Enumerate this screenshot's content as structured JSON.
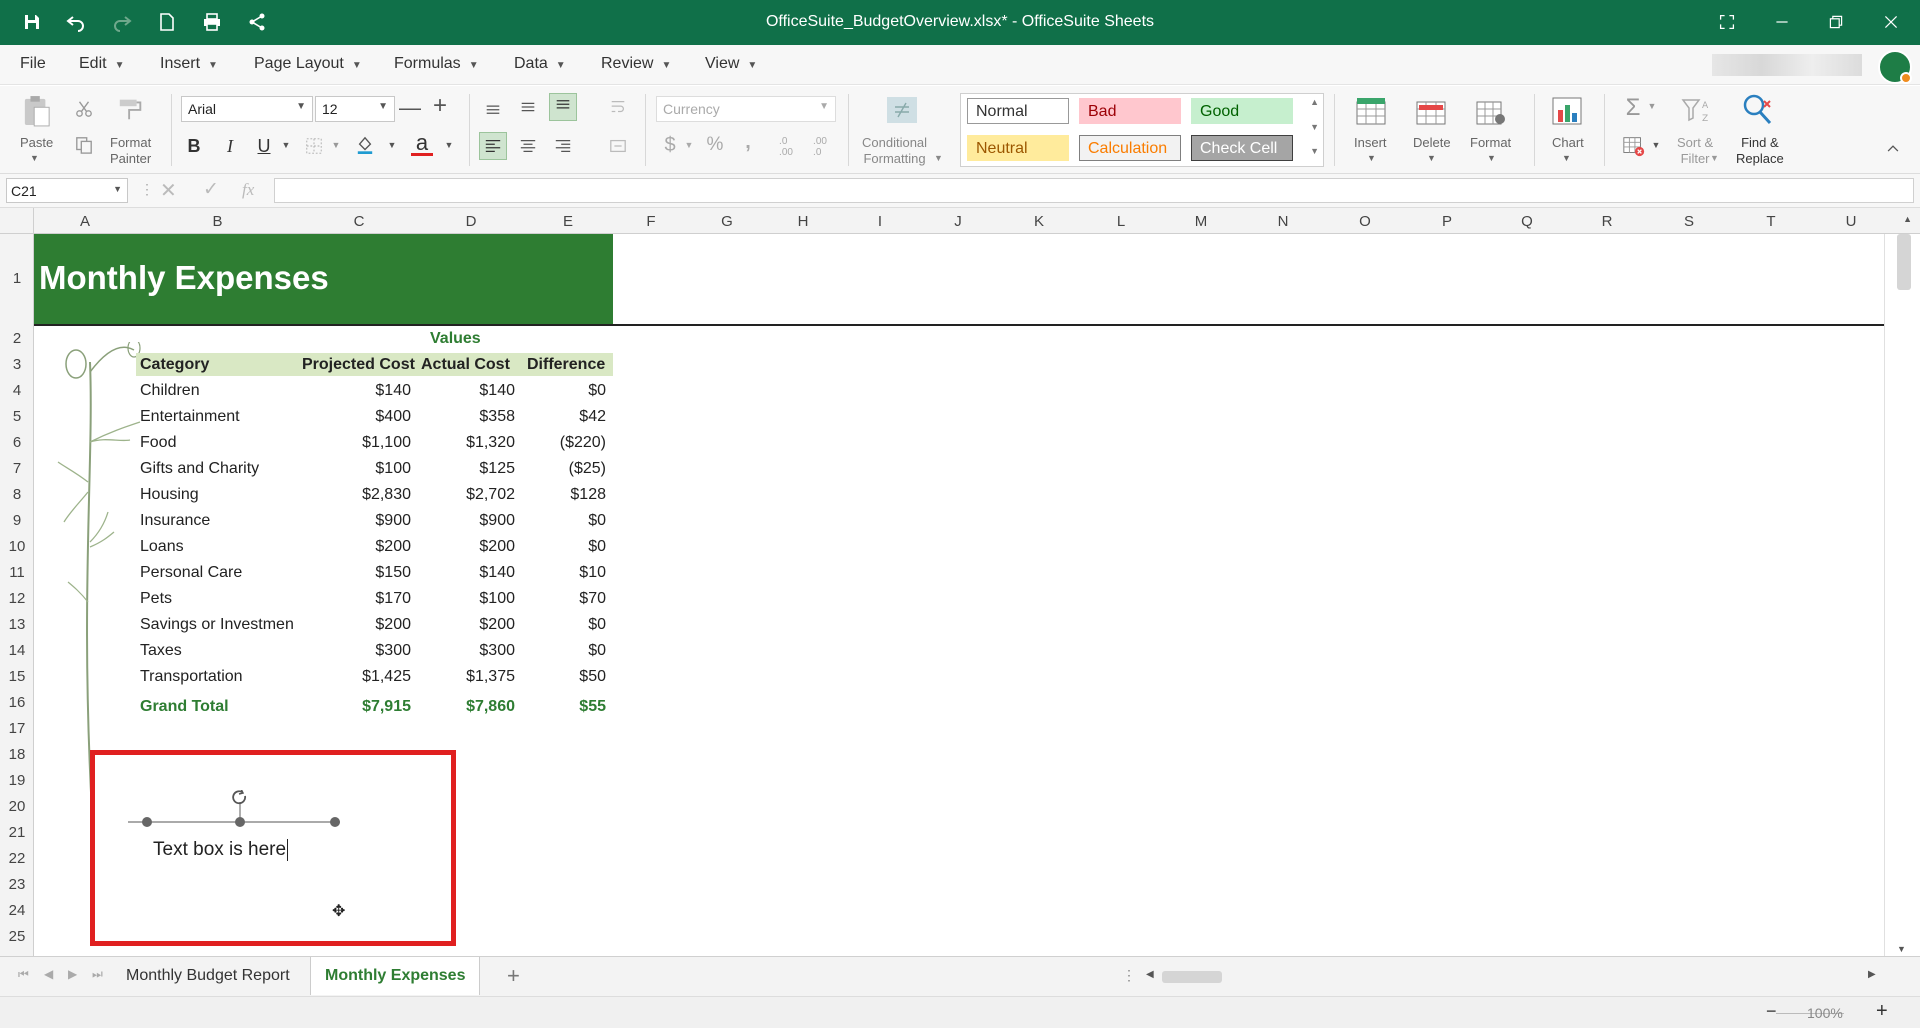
{
  "window": {
    "title": "OfficeSuite_BudgetOverview.xlsx* - OfficeSuite Sheets"
  },
  "menu": [
    "File",
    "Edit",
    "Insert",
    "Page Layout",
    "Formulas",
    "Data",
    "Review",
    "View"
  ],
  "ribbon": {
    "paste": "Paste",
    "format_painter": "Format\nPainter",
    "font_name": "Arial",
    "font_size": "12",
    "number_format": "Currency",
    "conditional_formatting": "Conditional\nFormatting",
    "styles": {
      "normal": "Normal",
      "bad": "Bad",
      "good": "Good",
      "neutral": "Neutral",
      "calculation": "Calculation",
      "check_cell": "Check Cell"
    },
    "insert": "Insert",
    "delete": "Delete",
    "format": "Format",
    "chart": "Chart",
    "sort_filter": "Sort &\nFilter",
    "find_replace": "Find &\nReplace",
    "sigma": "Σ",
    "bold": "B",
    "italic": "I",
    "underline": "U",
    "font_color_letter": "a",
    "dollar": "$",
    "percent": "%",
    "comma": ",",
    "increase_decimal": ".0\n.00",
    "decrease_decimal": ".00\n.0"
  },
  "formula_bar": {
    "name_box": "C21",
    "fx": "fx",
    "formula": ""
  },
  "columns": [
    "A",
    "B",
    "C",
    "D",
    "E",
    "F",
    "G",
    "H",
    "I",
    "J",
    "K",
    "L",
    "M",
    "N",
    "O",
    "P",
    "Q",
    "R",
    "S",
    "T",
    "U"
  ],
  "rows": [
    "1",
    "2",
    "3",
    "4",
    "5",
    "6",
    "7",
    "8",
    "9",
    "10",
    "11",
    "12",
    "13",
    "14",
    "15",
    "16",
    "17",
    "18",
    "19",
    "20",
    "21",
    "22",
    "23",
    "24",
    "25"
  ],
  "sheet": {
    "title": "Monthly Expenses",
    "values_label": "Values",
    "headers": [
      "Category",
      "Projected Cost",
      "Actual Cost",
      "Difference"
    ],
    "data": [
      [
        "Children",
        "$140",
        "$140",
        "$0"
      ],
      [
        "Entertainment",
        "$400",
        "$358",
        "$42"
      ],
      [
        "Food",
        "$1,100",
        "$1,320",
        "($220)"
      ],
      [
        "Gifts and Charity",
        "$100",
        "$125",
        "($25)"
      ],
      [
        "Housing",
        "$2,830",
        "$2,702",
        "$128"
      ],
      [
        "Insurance",
        "$900",
        "$900",
        "$0"
      ],
      [
        "Loans",
        "$200",
        "$200",
        "$0"
      ],
      [
        "Personal Care",
        "$150",
        "$140",
        "$10"
      ],
      [
        "Pets",
        "$170",
        "$100",
        "$70"
      ],
      [
        "Savings or Investmen",
        "$200",
        "$200",
        "$0"
      ],
      [
        "Taxes",
        "$300",
        "$300",
        "$0"
      ],
      [
        "Transportation",
        "$1,425",
        "$1,375",
        "$50"
      ]
    ],
    "total": [
      "Grand Total",
      "$7,915",
      "$7,860",
      "$55"
    ],
    "textbox": "Text box is here"
  },
  "tabs": {
    "sheet1": "Monthly Budget Report",
    "sheet2": "Monthly Expenses",
    "add": "+"
  },
  "status": {
    "zoom": "100%",
    "minus": "−",
    "plus": "+"
  },
  "colors": {
    "title_bar": "#107049",
    "title_band": "#2e7d32",
    "header_fill": "#d9e8c4",
    "selection": "#e02020"
  }
}
